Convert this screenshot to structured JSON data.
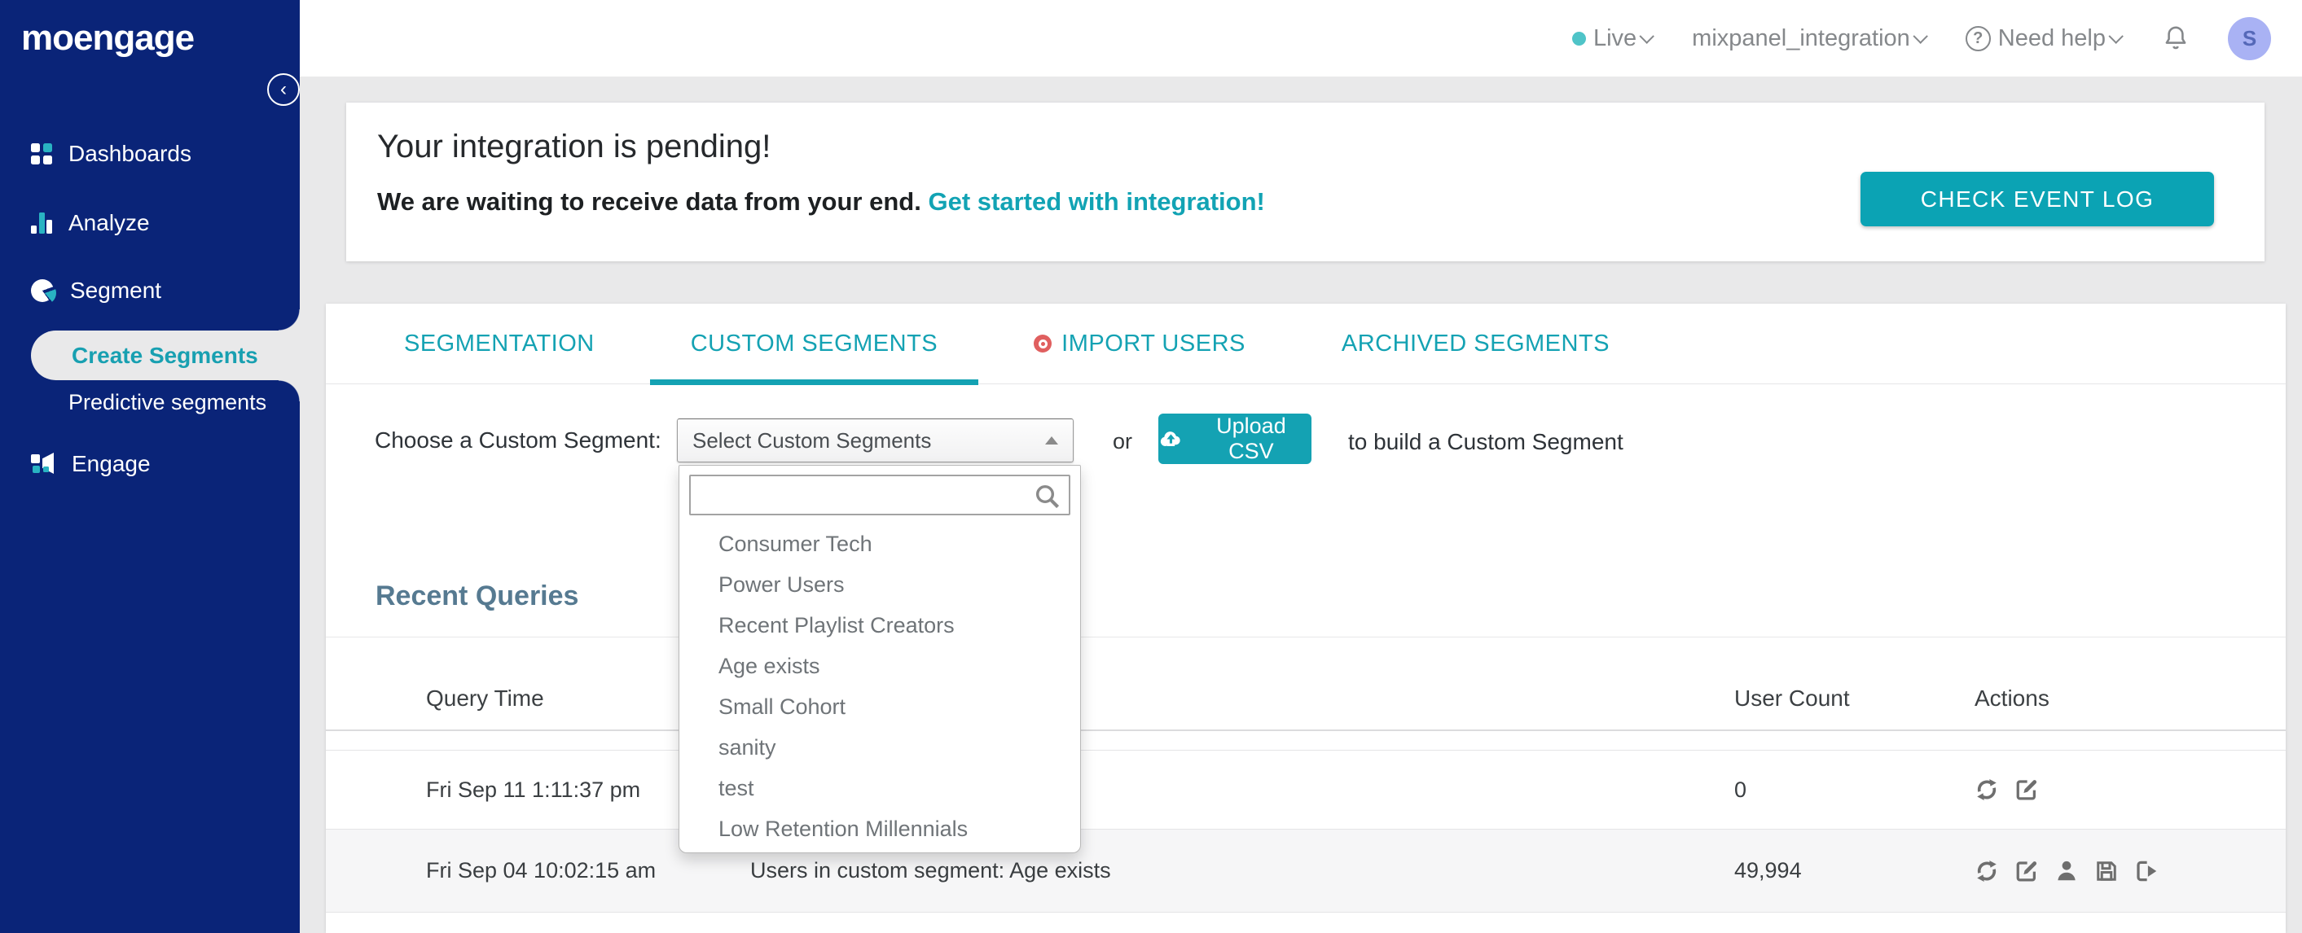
{
  "colors": {
    "navy": "#0a2478",
    "teal": "#12a3b4",
    "teal_icon": "#29b3c2",
    "page_bg": "#e9e9ea",
    "slate_heading": "#567a91",
    "import_dot_red": "#e05f5f",
    "avatar_bg": "#a9b2f4",
    "live_dot": "#4fc4c8",
    "row_alt_bg": "#f6f6f7"
  },
  "topbar": {
    "env_label": "Live",
    "project_name": "mixpanel_integration",
    "help_icon": "?",
    "help_label": "Need help",
    "avatar_initial": "S"
  },
  "sidebar": {
    "logo": "moengage",
    "collapse_glyph": "‹",
    "items": [
      {
        "label": "Dashboards",
        "icon": "grid-icon"
      },
      {
        "label": "Analyze",
        "icon": "bar-chart-icon"
      },
      {
        "label": "Segment",
        "icon": "pie-chart-icon"
      },
      {
        "label": "Engage",
        "icon": "megaphone-icon"
      }
    ],
    "subitems": [
      {
        "label": "Create Segments",
        "active": true
      },
      {
        "label": "Predictive segments",
        "active": false
      }
    ]
  },
  "banner": {
    "title": "Your integration is pending!",
    "subtitle": "We are waiting to receive data from your end.",
    "link_label": "Get started with integration!",
    "button_label": "CHECK EVENT LOG"
  },
  "tabs": [
    {
      "label": "SEGMENTATION",
      "active": false
    },
    {
      "label": "CUSTOM SEGMENTS",
      "active": true
    },
    {
      "label": "IMPORT USERS",
      "active": false,
      "badge": "red-target-dot"
    },
    {
      "label": "ARCHIVED SEGMENTS",
      "active": false
    }
  ],
  "chooser": {
    "label": "Choose a Custom Segment:",
    "select_value": "Select Custom Segments",
    "or_label": "or",
    "upload_label": "Upload CSV",
    "suffix_label": "to build a Custom Segment"
  },
  "dropdown": {
    "search_value": "",
    "items": [
      "Consumer Tech",
      "Power Users",
      "Recent Playlist Creators",
      "Age exists",
      "Small Cohort",
      "sanity",
      "test",
      "Low Retention Millennials"
    ]
  },
  "recent": {
    "heading": "Recent Queries",
    "columns": {
      "time": "Query Time",
      "count": "User Count",
      "actions": "Actions"
    },
    "rows": [
      {
        "time": "Fri Sep 11 1:11:37 pm",
        "description": "",
        "count": "0",
        "actions": [
          "refresh",
          "edit"
        ]
      },
      {
        "time": "Fri Sep 04 10:02:15 am",
        "description": "Users in custom segment: Age exists",
        "count": "49,994",
        "actions": [
          "refresh",
          "edit",
          "user",
          "save",
          "export"
        ]
      }
    ]
  }
}
